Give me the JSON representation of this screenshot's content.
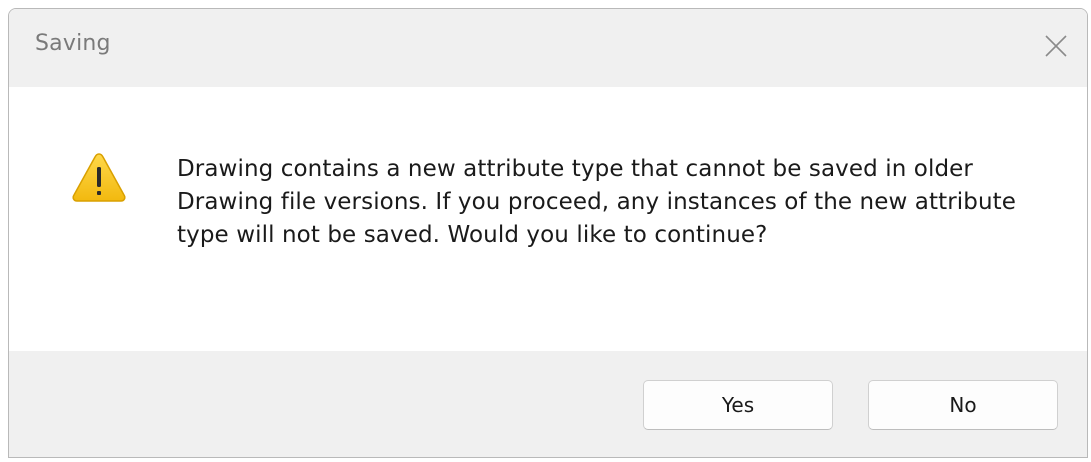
{
  "dialog": {
    "title": "Saving",
    "message": "Drawing contains a new attribute type that cannot be saved in older Drawing file versions. If you proceed, any instances of the new attribute type will not be saved. Would you like to continue?",
    "icon": "warning-icon",
    "close_icon": "close-icon",
    "buttons": {
      "yes_label": "Yes",
      "no_label": "No"
    },
    "colors": {
      "warning_fill": "#f5c518",
      "warning_stroke": "#d9a000",
      "title_bar": "#f0f0f0",
      "footer": "#f0f0f0"
    }
  }
}
